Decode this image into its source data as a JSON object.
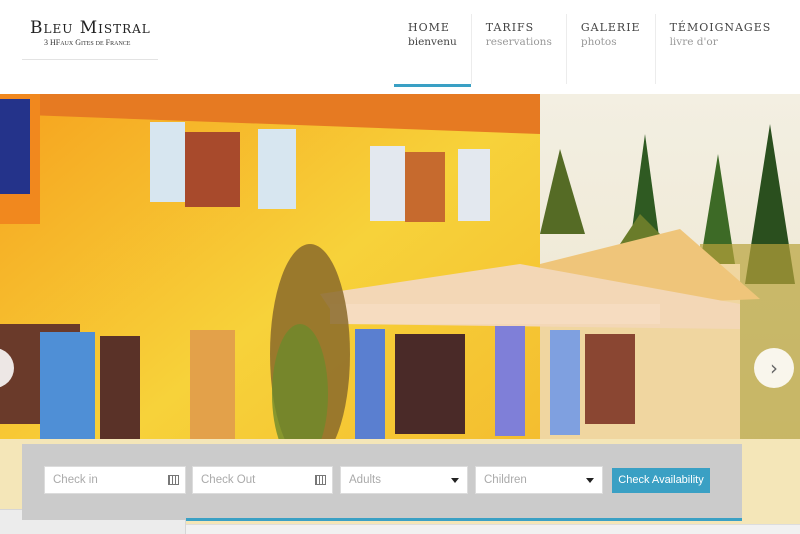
{
  "logo": {
    "title": "Bleu Mistral",
    "subtitle": "3 HFaux Gites de France"
  },
  "nav": {
    "items": [
      {
        "label": "HOME",
        "sub": "bienvenu"
      },
      {
        "label": "TARIFS",
        "sub": "reservations"
      },
      {
        "label": "GALERIE",
        "sub": "photos"
      },
      {
        "label": "TÉMOIGNAGES",
        "sub": "livre d'or"
      }
    ],
    "active_index": 0
  },
  "slider": {
    "prev_icon": "chevron-left-icon",
    "next_icon": "chevron-right-icon",
    "prev_glyph": "‹",
    "next_glyph": "›"
  },
  "booking": {
    "checkin_placeholder": "Check in",
    "checkout_placeholder": "Check Out",
    "adults_value": "Adults",
    "children_value": "Children",
    "button_label": "Check Availability"
  },
  "colors": {
    "accent": "#3aa0c4",
    "booking_bg": "#cbcbcb"
  }
}
